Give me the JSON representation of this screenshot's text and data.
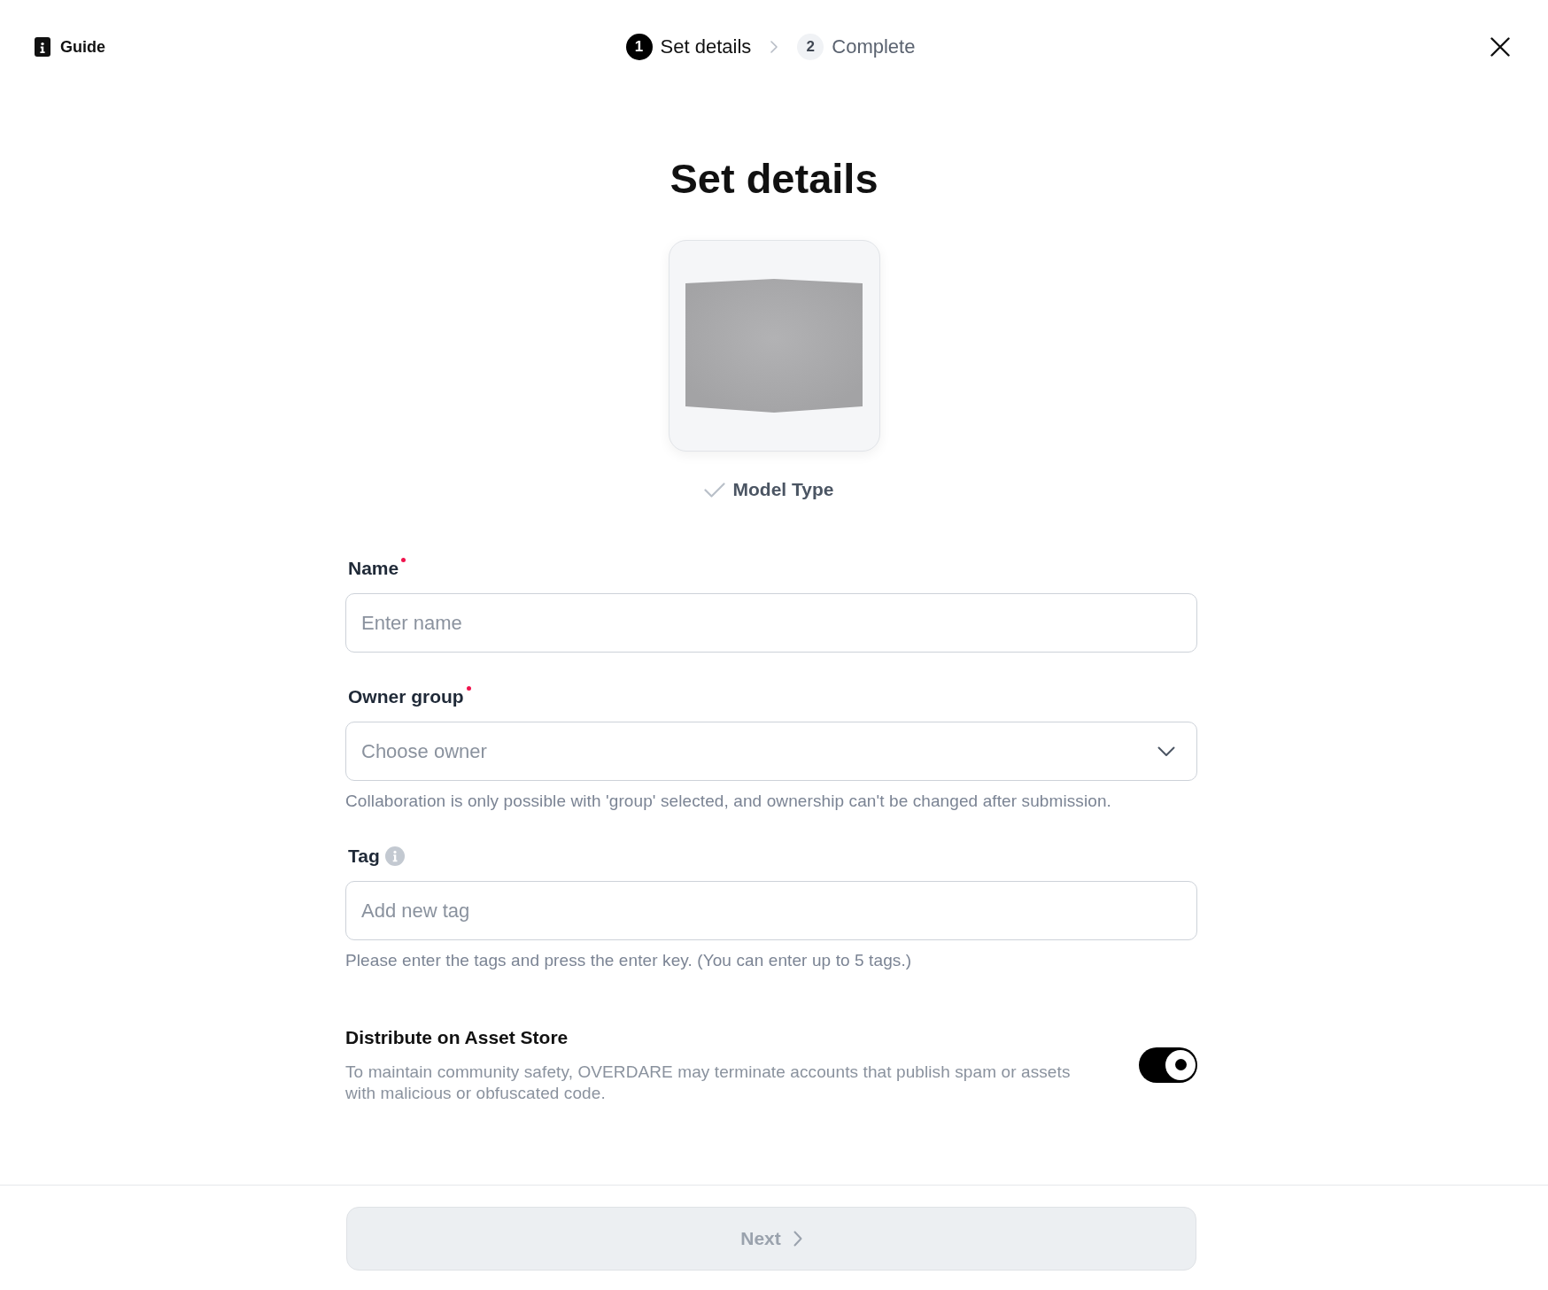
{
  "header": {
    "guide": {
      "label": "Guide"
    },
    "steps": [
      {
        "number": "1",
        "label": "Set details",
        "selected": true
      },
      {
        "number": "2",
        "label": "Complete",
        "selected": false
      }
    ]
  },
  "title": "Set details",
  "model_type": {
    "label": "Model Type",
    "checked": true
  },
  "form": {
    "fields": [
      {
        "kind": "text",
        "label": "Name",
        "required": true,
        "info": false,
        "placeholder": "Enter name"
      },
      {
        "kind": "select",
        "label": "Owner group",
        "required": true,
        "info": false,
        "placeholder": "Choose owner",
        "help": "Collaboration is only possible with 'group' selected, and ownership can't be changed after submission."
      },
      {
        "kind": "text",
        "label": "Tag",
        "required": false,
        "info": true,
        "placeholder": "Add new tag",
        "help": "Please enter the tags and press the enter key. (You can enter up to 5 tags.)"
      }
    ]
  },
  "distribute": {
    "title": "Distribute on Asset Store",
    "description": "To maintain community safety, OVERDARE may terminate accounts that publish spam or assets with malicious or obfuscated code.",
    "on": true
  },
  "next_button": {
    "label": "Next",
    "disabled": true
  }
}
